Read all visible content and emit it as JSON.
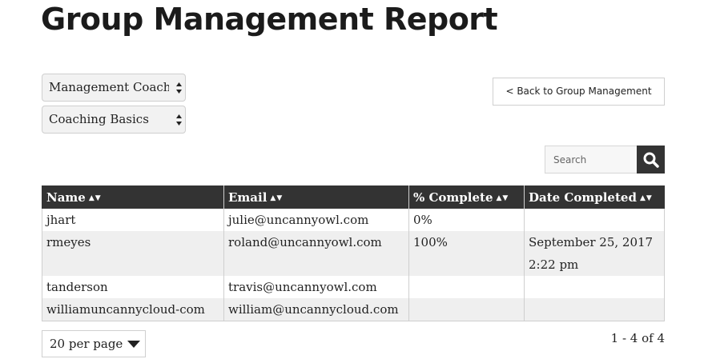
{
  "page": {
    "title": "Group Management Report"
  },
  "filters": {
    "group_select": "Management Coaching",
    "course_select": "Coaching Basics"
  },
  "back_button": {
    "label": "< Back to Group Management"
  },
  "search": {
    "placeholder": "Search",
    "icon": "search-icon"
  },
  "table": {
    "columns": [
      "Name",
      "Email",
      "% Complete",
      "Date Completed"
    ],
    "rows": [
      {
        "name": "jhart",
        "email": "julie@uncannyowl.com",
        "complete": "0%",
        "date_line1": "",
        "date_line2": ""
      },
      {
        "name": "rmeyes",
        "email": "roland@uncannyowl.com",
        "complete": "100%",
        "date_line1": "September 25, 2017",
        "date_line2": "2:22 pm"
      },
      {
        "name": "tanderson",
        "email": "travis@uncannyowl.com",
        "complete": "",
        "date_line1": "",
        "date_line2": ""
      },
      {
        "name": "williamuncannycloud-com",
        "email": "william@uncannycloud.com",
        "complete": "",
        "date_line1": "",
        "date_line2": ""
      }
    ]
  },
  "pagination": {
    "per_page": "20 per page",
    "info": "1 - 4 of 4"
  },
  "colors": {
    "header_bg": "#333333",
    "row_alt_bg": "#efefef"
  }
}
